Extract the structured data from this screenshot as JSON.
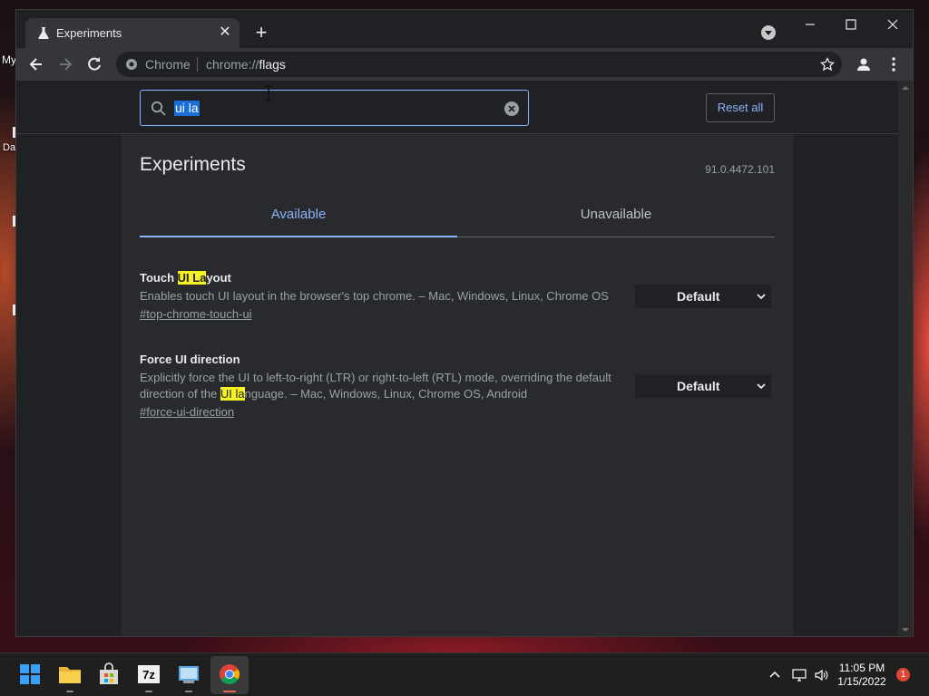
{
  "desktop": {
    "labels": [
      "My",
      "Da"
    ]
  },
  "browser": {
    "tab": {
      "title": "Experiments",
      "favicon": "flask-icon",
      "close": "close-icon"
    },
    "new_tab": "plus-icon",
    "omnibox": {
      "chip": "Chrome",
      "url_scheme": "chrome://",
      "url_host": "flags"
    }
  },
  "flags_page": {
    "search": {
      "value": "ui la"
    },
    "reset_label": "Reset all",
    "title": "Experiments",
    "version": "91.0.4472.101",
    "tabs": [
      {
        "label": "Available",
        "active": true
      },
      {
        "label": "Unavailable",
        "active": false
      }
    ],
    "experiments": [
      {
        "name_before": "Touch ",
        "name_highlight": "UI La",
        "name_after": "yout",
        "description": "Enables touch UI layout in the browser's top chrome. – Mac, Windows, Linux, Chrome OS",
        "link": "#top-chrome-touch-ui",
        "value": "Default"
      },
      {
        "name": "Force UI direction",
        "desc_before": "Explicitly force the UI to left-to-right (LTR) or right-to-left (RTL) mode, overriding the default direction of the ",
        "desc_highlight": "UI la",
        "desc_after": "nguage. – Mac, Windows, Linux, Chrome OS, Android",
        "link": "#force-ui-direction",
        "value": "Default"
      }
    ]
  },
  "taskbar": {
    "apps": [
      "start-icon",
      "file-explorer-icon",
      "store-icon",
      "7zip-icon",
      "control-panel-icon",
      "chrome-icon"
    ],
    "clock_time": "11:05 PM",
    "clock_date": "1/15/2022",
    "notification_count": "1"
  },
  "colors": {
    "accent": "#8ab4f8",
    "highlight": "#f5f224",
    "selection": "#1a6ed8"
  }
}
